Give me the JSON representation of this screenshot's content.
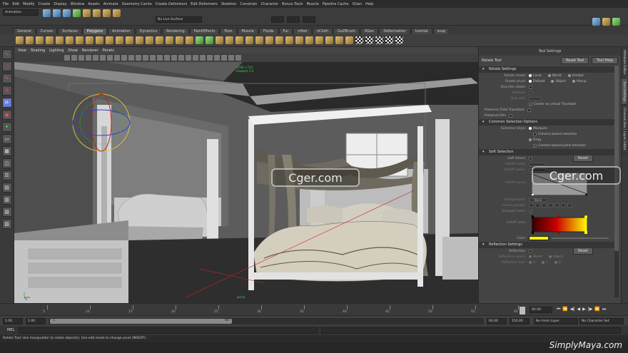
{
  "menubar": [
    "File",
    "Edit",
    "Modify",
    "Create",
    "Display",
    "Window",
    "Assets",
    "Animate",
    "Geometry Cache",
    "Create Deformers",
    "Edit Deformers",
    "Skeleton",
    "Constrain",
    "Character",
    "Bonus Tools",
    "Muscle",
    "Pipeline Cache",
    "XGen",
    "Help"
  ],
  "status": {
    "mode": "Animation",
    "live_surface": "No Live Surface"
  },
  "shelf_tabs": [
    {
      "label": "General",
      "active": false
    },
    {
      "label": "Curves",
      "active": false
    },
    {
      "label": "Surfaces",
      "active": false
    },
    {
      "label": "Polygons",
      "active": true
    },
    {
      "label": "Animation",
      "active": false
    },
    {
      "label": "Dynamics",
      "active": false
    },
    {
      "label": "Rendering",
      "active": false
    },
    {
      "label": "PaintEffects",
      "active": false
    },
    {
      "label": "Toon",
      "active": false
    },
    {
      "label": "Muscle",
      "active": false
    },
    {
      "label": "Fluids",
      "active": false
    },
    {
      "label": "Fur",
      "active": false
    },
    {
      "label": "nHair",
      "active": false
    },
    {
      "label": "nCloth",
      "active": false
    },
    {
      "label": "GoZBrush",
      "active": false
    },
    {
      "label": "XGen",
      "active": false
    },
    {
      "label": "Deformation",
      "active": false
    },
    {
      "label": "tutorial",
      "active": false
    },
    {
      "label": "ssup",
      "active": false
    }
  ],
  "viewport": {
    "menu": [
      "View",
      "Shading",
      "Lighting",
      "Show",
      "Renderer",
      "Panels"
    ],
    "resolution": "1280 x 720",
    "viewport_label": "Viewport 2.0",
    "camera": "persp",
    "watermark": "Cger.com"
  },
  "attribute_editor": {
    "title": "Tool Settings",
    "tool_name": "Rotate Tool",
    "reset_button": "Reset Tool",
    "help_button": "Tool Help",
    "sections": {
      "rotate": "Rotate Settings",
      "common": "Common Selection Options",
      "soft": "Soft Selection",
      "reflection": "Reflection Settings"
    },
    "rotate_mode": {
      "label": "Rotate mode:",
      "options": [
        "Local",
        "World",
        "Gimbal"
      ]
    },
    "rotate_pivot": {
      "label": "Rotate pivot:",
      "options": [
        "Default",
        "Object",
        "Manip"
      ]
    },
    "discrete": "Discrete rotate:",
    "relative": "Relative:",
    "step_size": "Step size:",
    "center_trackball": "Center as virtual Trackball",
    "preserve_child": "Preserve Child Transform",
    "preserve_uvs": "Preserve UVs",
    "selection_style": {
      "label": "Selection Style:",
      "marquee": "Marquee",
      "camera_based": "Camera based selection",
      "drag": "Drag",
      "camera_paint": "Camera based paint selection"
    },
    "soft_select": "Soft Select:",
    "soft_reset": "Reset",
    "falloff_mode": "Falloff mode:",
    "falloff_radius": "Falloff radius:",
    "falloff_curve": "Falloff curve:",
    "interpolation": "Interpolation:",
    "interpolation_value": "None",
    "curve_presets": "Curve presets:",
    "viewport_color": "Viewport color:",
    "falloff_color": "Falloff color:",
    "color": "Color:",
    "reflection": "Reflection:",
    "reflection_reset": "Reset",
    "reflection_space": "Reflection space:",
    "reflection_space_opts": [
      "World",
      "Object"
    ],
    "reflection_axis": "Reflection axis:",
    "reflection_axis_opts": [
      "X",
      "Y",
      "Z"
    ]
  },
  "side_tabs": [
    "Attribute Editor",
    "Tool Settings",
    "Channel Box / Layer Editor"
  ],
  "timeline": {
    "ticks": [
      "5",
      "10",
      "15",
      "20",
      "25",
      "30",
      "35",
      "40",
      "45",
      "50",
      "55",
      "60"
    ],
    "current": "60.00",
    "start": "1.00",
    "start2": "1.00",
    "range_start": "1",
    "range_end": "60",
    "end": "60.00",
    "end2": "150.00",
    "anim_layer": "No Anim Layer",
    "char_set": "No Character Set"
  },
  "mel": {
    "label": "MEL"
  },
  "helpline": "Rotate Tool: Use manipulator to rotate object(s). Use edit mode to change pivot (INSERT).",
  "brand": "SimplyMaya.com"
}
